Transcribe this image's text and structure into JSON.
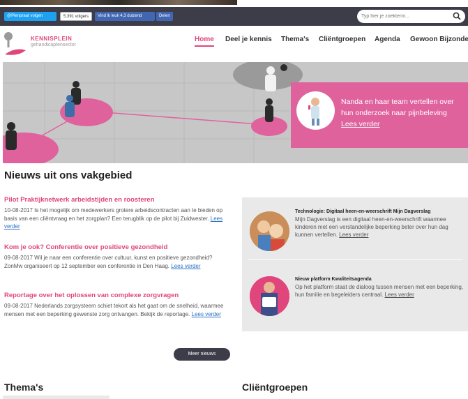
{
  "social": {
    "twitter_label": "@Plenpraat volgen",
    "twitter_count": "5.391 volgers",
    "facebook_label": "Vind ik leuk 4,3 duizend",
    "facebook_share": "Delen"
  },
  "search": {
    "placeholder": "Typ hier je zoekterm..."
  },
  "logo": {
    "line1": "KENNISPLEIN",
    "line2": "gehandicaptensector"
  },
  "nav": {
    "items": [
      "Home",
      "Deel je kennis",
      "Thema's",
      "Cliëntgroepen",
      "Agenda",
      "Gewoon Bijzonder"
    ],
    "active": "Home"
  },
  "hero": {
    "text": "Nanda en haar team vertellen over hun onderzoek naar pijnbeleving",
    "link": "Lees verder"
  },
  "news": {
    "title": "Nieuws uit ons vakgebied",
    "items": [
      {
        "title": "Pilot Praktijknetwerk arbeidstijden en roosteren",
        "body": "10-08-2017 Is het mogelijk om medewerkers grotere arbeidscontracten aan te bieden op basis van een cliëntvraag en het zorgplan? Een terugblik op de pilot bij Zuidwester.",
        "link": "Lees verder"
      },
      {
        "title": "Kom je ook? Conferentie over positieve gezondheid",
        "body": "09-08-2017 Wil je naar een conferentie over cultuur, kunst en positieve gezondheid? ZonMw organiseert op 12 september een conferentie in Den Haag.",
        "link": "Lees verder"
      },
      {
        "title": "Reportage over het oplossen van complexe zorgvragen",
        "body": "09-08-2017 Nederlands zorgsysteem schiet tekort als het gaat om de snelheid, waarmee mensen met een beperking gewenste zorg ontvangen. Bekijk de reportage.",
        "link": "Lees verder"
      }
    ],
    "more_label": "Meer nieuws"
  },
  "sidebar": {
    "items": [
      {
        "title": "Technologie: Digitaal heen-en-weerschrift Mijn Dagverslag",
        "body": "Mijn Dagverslag is een digitaal heen-en-weerschrift waarmee kinderen met een verstandelijke beperking beter over hun dag kunnen vertellen.",
        "link": "Lees verder"
      },
      {
        "title": "Nieuw platform Kwaliteitsagenda",
        "body": "Op het platform staat de dialoog tussen mensen met een beperking, hun familie en begeleiders centraal.",
        "link": "Lees verder"
      }
    ]
  },
  "sections": {
    "themas": "Thema's",
    "clientgroepen": "Cliëntgroepen"
  },
  "colors": {
    "brand_pink": "#e0457b",
    "topbar": "#3d3d4a",
    "link_blue": "#2a6fc2"
  }
}
